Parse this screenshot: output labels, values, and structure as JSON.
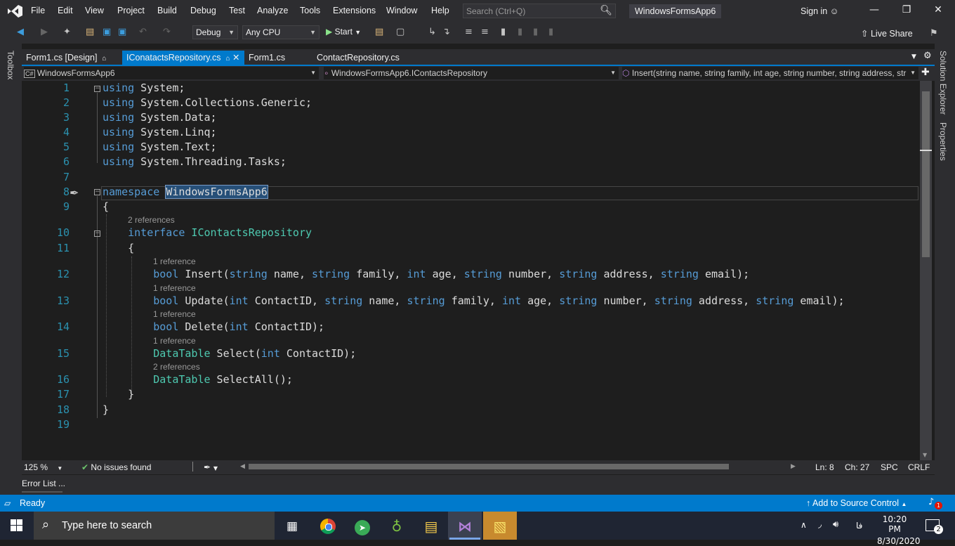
{
  "menubar": {
    "items": [
      "File",
      "Edit",
      "View",
      "Project",
      "Build",
      "Debug",
      "Test",
      "Analyze",
      "Tools",
      "Extensions",
      "Window",
      "Help"
    ],
    "search_placeholder": "Search (Ctrl+Q)",
    "solution_name": "WindowsFormsApp6",
    "sign_in": "Sign in"
  },
  "toolbar": {
    "configuration": "Debug",
    "platform": "Any CPU",
    "start_label": "Start",
    "live_share": "Live Share"
  },
  "side": {
    "toolbox": "Toolbox",
    "solution_explorer": "Solution Explorer",
    "properties": "Properties"
  },
  "tabs": [
    {
      "label": "Form1.cs [Design]"
    },
    {
      "label": "IConatactsRepository.cs"
    },
    {
      "label": "Form1.cs"
    },
    {
      "label": "ContactRepository.cs"
    }
  ],
  "navbar": {
    "project": "WindowsFormsApp6",
    "type": "WindowsFormsApp6.IContactsRepository",
    "member": "Insert(string name, string family, int age, string number, string address, str"
  },
  "editor": {
    "line_numbers": [
      "1",
      "2",
      "3",
      "4",
      "5",
      "6",
      "7",
      "8",
      "9",
      "10",
      "11",
      "12",
      "13",
      "14",
      "15",
      "16",
      "17",
      "18",
      "19"
    ],
    "lines": {
      "l1": [
        "using",
        " System;"
      ],
      "l2": [
        "using",
        " System.Collections.Generic;"
      ],
      "l3": [
        "using",
        " System.Data;"
      ],
      "l4": [
        "using",
        " System.Linq;"
      ],
      "l5": [
        "using",
        " System.Text;"
      ],
      "l6": [
        "using",
        " System.Threading.Tasks;"
      ],
      "l8_kw": "namespace",
      "l8_name": "WindowsFormsApp6",
      "l9": "{",
      "l10_kw": "interface",
      "l10_name": " IContactsRepository",
      "l11": "{",
      "l17": "}",
      "l18": "}"
    },
    "lens": {
      "interface_refs": "2 references",
      "insert_refs": "1 reference",
      "update_refs": "1 reference",
      "delete_refs": "1 reference",
      "select_refs": "1 reference",
      "selectall_refs": "2 references"
    }
  },
  "editor_status": {
    "zoom": "125 %",
    "issues": "No issues found",
    "line": "Ln: 8",
    "col": "Ch: 27",
    "spc": "SPC",
    "crlf": "CRLF"
  },
  "error_list": "Error List ...",
  "statusbar": {
    "ready": "Ready",
    "source_control": "Add to Source Control",
    "notif_count": "1"
  },
  "taskbar": {
    "search_placeholder": "Type here to search",
    "time": "10:20 PM",
    "date": "8/30/2020",
    "lang": "فا",
    "notifications": "2"
  },
  "colors": {
    "accent": "#007acc",
    "keyword": "#569cd6",
    "type": "#4ec9b0",
    "line_number": "#2b91af"
  }
}
